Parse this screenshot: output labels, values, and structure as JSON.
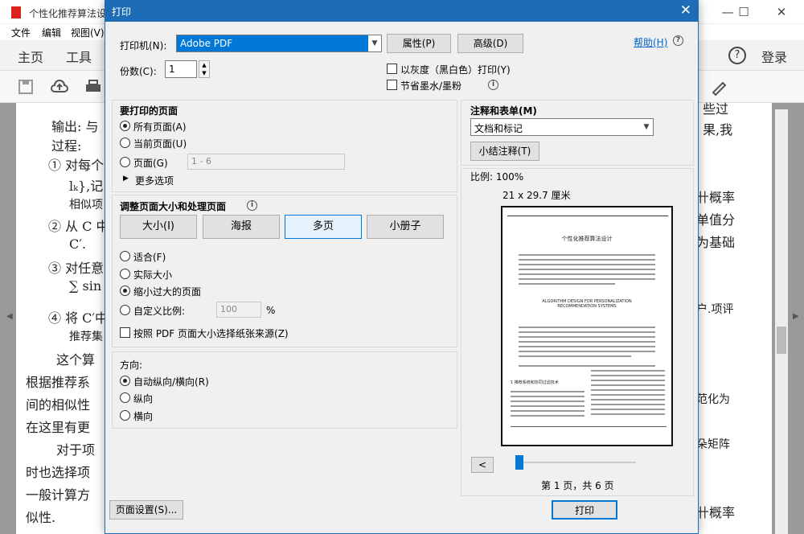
{
  "app": {
    "title": "个性化推荐算法设",
    "win_minimize": "—",
    "win_maximize": "☐",
    "win_close": "✕",
    "menu": [
      "文件",
      "编辑",
      "视图(V)"
    ],
    "toolbar": {
      "home": "主页",
      "tools": "工具",
      "help_icon": "?",
      "login": "登录"
    }
  },
  "document": {
    "lines": [
      "输出: 与",
      "过程:",
      "① 对每个",
      "lₖ},记",
      "相似项",
      "② 从 C 中",
      "C′.",
      "③ 对任意",
      "∑ sin",
      "④ 将 C′中",
      "推荐集",
      "这个算",
      "根据推荐系",
      "间的相似性",
      "在这里有更",
      "对于项",
      "时也选择项",
      "一般计算方",
      "似性."
    ],
    "right_lines": [
      "些过",
      "果,我",
      "卄概率",
      "单值分",
      "为基础",
      "户.项评",
      "范化为",
      "朵矩阵",
      "卄概率"
    ]
  },
  "dialog": {
    "title": "打印",
    "close": "✕",
    "printer_label": "打印机(N):",
    "printer_value": "Adobe PDF",
    "properties_button": "属性(P)",
    "advanced_button": "高级(D)",
    "help_link": "帮助(H)",
    "copies_label": "份数(C):",
    "copies_value": "1",
    "grayscale_label": "以灰度（黑白色）打印(Y)",
    "save_ink_label": "节省墨水/墨粉",
    "pages_section": {
      "title": "要打印的页面",
      "all": "所有页面(A)",
      "current": "当前页面(U)",
      "pages": "页面(G)",
      "pages_placeholder": "1 - 6",
      "more": "更多选项"
    },
    "size_section": {
      "title": "调整页面大小和处理页面",
      "tabs": [
        "大小(I)",
        "海报",
        "多页",
        "小册子"
      ],
      "fit": "适合(F)",
      "actual": "实际大小",
      "shrink": "缩小过大的页面",
      "custom": "自定义比例:",
      "custom_value": "100",
      "percent": "%",
      "by_source": "按照 PDF 页面大小选择纸张来源(Z)"
    },
    "orientation_section": {
      "title": "方向:",
      "auto": "自动纵向/横向(R)",
      "portrait": "纵向",
      "landscape": "横向"
    },
    "comments_section": {
      "title": "注释和表单(M)",
      "value": "文档和标记",
      "summary_button": "小结注释(T)"
    },
    "preview": {
      "scale": "比例: 100%",
      "size": "21 x 29.7 厘米",
      "page_info": "第 1 页，共 6 页",
      "prev_button": "<",
      "paper_title": "个性化推荐算法设计",
      "paper_en_title": "ALGORITHM DESIGN FOR PERSONALIZATION RECOMMENDATION SYSTEMS",
      "section_heading": "1 推荐系统和协同过滤技术"
    },
    "page_setup_button": "页面设置(S)...",
    "print_button": "打印"
  }
}
